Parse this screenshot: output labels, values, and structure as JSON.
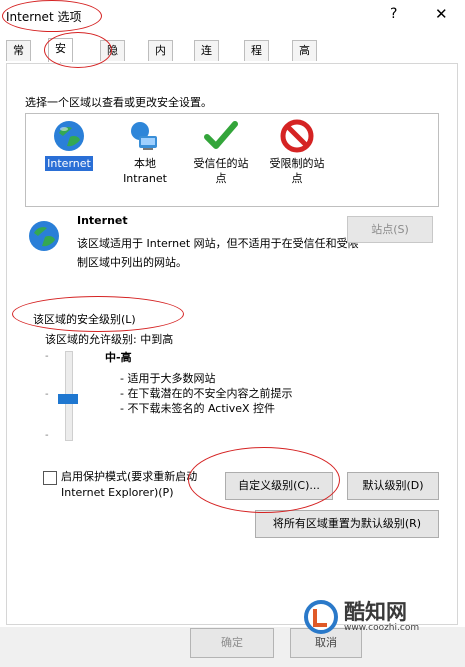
{
  "window": {
    "title": "Internet 选项",
    "help": "?",
    "close": "✕"
  },
  "tabs": [
    {
      "label": "常规"
    },
    {
      "label": "安全",
      "active": true
    },
    {
      "label": "隐私"
    },
    {
      "label": "内容"
    },
    {
      "label": "连接"
    },
    {
      "label": "程序"
    },
    {
      "label": "高级"
    }
  ],
  "security": {
    "intro": "选择一个区域以查看或更改安全设置。",
    "zones": [
      {
        "name": "internet",
        "label": "Internet",
        "icon": "globe-icon",
        "selected": true
      },
      {
        "name": "intranet",
        "label": "本地\nIntranet",
        "icon": "intranet-icon"
      },
      {
        "name": "trusted",
        "label": "受信任的站\n点",
        "icon": "checkmark-icon"
      },
      {
        "name": "restricted",
        "label": "受限制的站\n点",
        "icon": "restricted-icon"
      }
    ],
    "detail": {
      "title": "Internet",
      "description": "该区域适用于 Internet 网站，但不适用于在受信任和受限制区域中列出的网站。",
      "sites_button": "站点(S)"
    },
    "level_group": {
      "legend": "该区域的安全级别(L)",
      "allowed": "该区域的允许级别: 中到高",
      "level_name": "中-高",
      "bullets": [
        "- 适用于大多数网站",
        "- 在下载潜在的不安全内容之前提示",
        "- 不下载未签名的 ActiveX 控件"
      ],
      "slider_position": 0.5
    },
    "protected_mode": "启用保护模式(要求重新启动 Internet Explorer)(P)",
    "buttons": {
      "custom": "自定义级别(C)...",
      "default": "默认级别(D)",
      "reset": "将所有区域重置为默认级别(R)"
    }
  },
  "footer": {
    "ok": "确定",
    "cancel": "取消"
  },
  "watermark": {
    "name": "酷知网",
    "url": "www.coozhi.com"
  },
  "colors": {
    "selected_zone": "#2a6fd6",
    "annotation": "#d52323",
    "slider_thumb": "#1f77d0"
  }
}
